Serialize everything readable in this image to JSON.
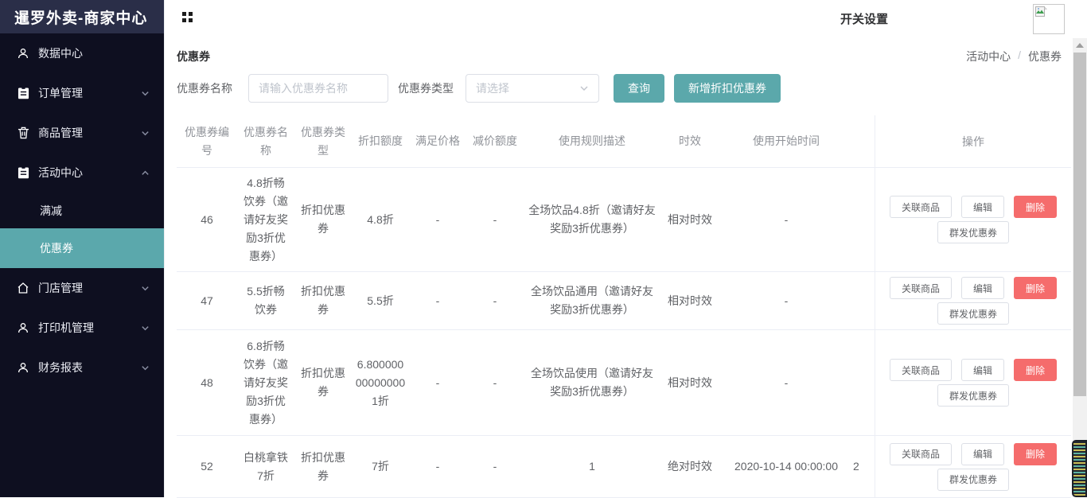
{
  "colors": {
    "sidebar_bg": "#0e0f20",
    "logo_bg": "#2a2e48",
    "accent_teal": "#5ba8ac",
    "danger_red": "#f56c6c",
    "table_border": "#ebeef5"
  },
  "sidebar": {
    "title": "暹罗外卖-商家中心",
    "items": [
      {
        "label": "数据中心",
        "icon": "user-icon"
      },
      {
        "label": "订单管理",
        "icon": "clipboard-icon",
        "chevron": "down"
      },
      {
        "label": "商品管理",
        "icon": "trash-icon",
        "chevron": "down"
      },
      {
        "label": "活动中心",
        "icon": "clipboard-icon",
        "chevron": "up",
        "children": [
          {
            "label": "满减",
            "active": false
          },
          {
            "label": "优惠券",
            "active": true
          }
        ]
      },
      {
        "label": "门店管理",
        "icon": "home-icon",
        "chevron": "down"
      },
      {
        "label": "打印机管理",
        "icon": "user-icon",
        "chevron": "down"
      },
      {
        "label": "财务报表",
        "icon": "user-icon",
        "chevron": "down"
      }
    ]
  },
  "header": {
    "settings_label": "开关设置"
  },
  "page": {
    "title": "优惠券",
    "breadcrumb": {
      "parent": "活动中心",
      "separator": "/",
      "current": "优惠券"
    }
  },
  "filters": {
    "name_label": "优惠券名称",
    "name_placeholder": "请输入优惠券名称",
    "type_label": "优惠券类型",
    "type_placeholder": "请选择",
    "search_button": "查询",
    "add_button": "新增折扣优惠券"
  },
  "table": {
    "columns": [
      "优惠券编号",
      "优惠券名称",
      "优惠券类型",
      "折扣额度",
      "满足价格",
      "减价额度",
      "使用规则描述",
      "时效",
      "使用开始时间",
      "操作"
    ],
    "rows": [
      {
        "id": "46",
        "name": "4.8折畅饮券（邀请好友奖励3折优惠券）",
        "type": "折扣优惠券",
        "discount": "4.8折",
        "min_price": "-",
        "reduce": "-",
        "rule": "全场饮品4.8折（邀请好友奖励3折优惠券）",
        "validity": "相对时效",
        "start_time": "-",
        "end_time_partial": ""
      },
      {
        "id": "47",
        "name": "5.5折畅饮券",
        "type": "折扣优惠券",
        "discount": "5.5折",
        "min_price": "-",
        "reduce": "-",
        "rule": "全场饮品通用（邀请好友奖励3折优惠券）",
        "validity": "相对时效",
        "start_time": "-",
        "end_time_partial": ""
      },
      {
        "id": "48",
        "name": "6.8折畅饮券（邀请好友奖励3折优惠券）",
        "type": "折扣优惠券",
        "discount": "6.800000000000001折",
        "min_price": "-",
        "reduce": "-",
        "rule": "全场饮品使用（邀请好友奖励3折优惠券）",
        "validity": "相对时效",
        "start_time": "-",
        "end_time_partial": ""
      },
      {
        "id": "52",
        "name": "白桃拿铁7折",
        "type": "折扣优惠券",
        "discount": "7折",
        "min_price": "-",
        "reduce": "-",
        "rule": "1",
        "validity": "绝对时效",
        "start_time": "2020-10-14 00:00:00",
        "end_time_partial": "2"
      }
    ],
    "actions": {
      "link_product": "关联商品",
      "edit": "编辑",
      "delete": "删除",
      "bulk_send": "群发优惠券"
    }
  }
}
